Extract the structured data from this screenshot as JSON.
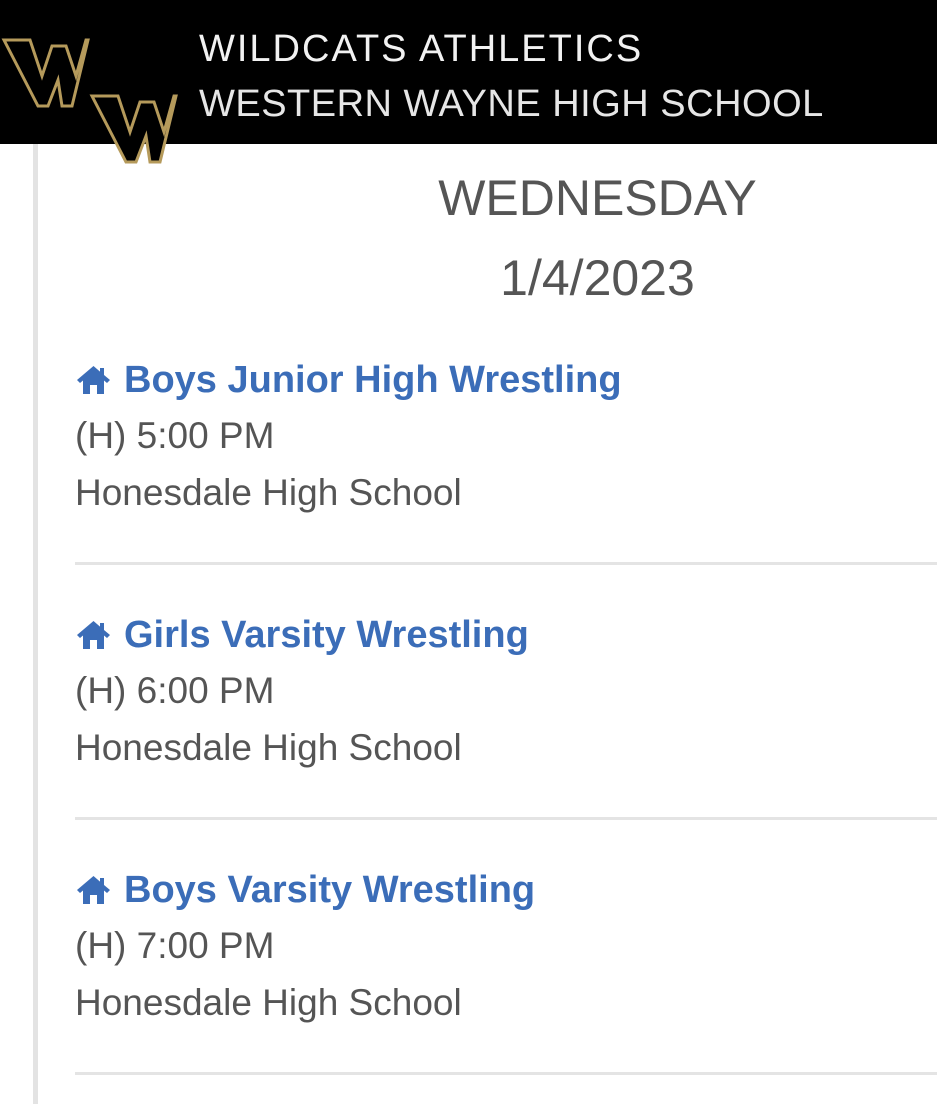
{
  "header": {
    "logo_text": "WW",
    "title": "WILDCATS ATHLETICS",
    "subtitle": "WESTERN WAYNE HIGH SCHOOL"
  },
  "schedule": {
    "day_name": "WEDNESDAY",
    "date": "1/4/2023",
    "events": [
      {
        "icon": "home-icon",
        "title": "Boys Junior High Wrestling",
        "time": "(H) 5:00 PM",
        "location": "Honesdale High School"
      },
      {
        "icon": "home-icon",
        "title": "Girls Varsity Wrestling",
        "time": "(H) 6:00 PM",
        "location": "Honesdale High School"
      },
      {
        "icon": "home-icon",
        "title": "Boys Varsity Wrestling",
        "time": "(H) 7:00 PM",
        "location": "Honesdale High School"
      }
    ]
  },
  "colors": {
    "header_background": "#000000",
    "link_blue": "#3b6db8",
    "body_text": "#555555",
    "logo_gold": "#b59a5b"
  }
}
